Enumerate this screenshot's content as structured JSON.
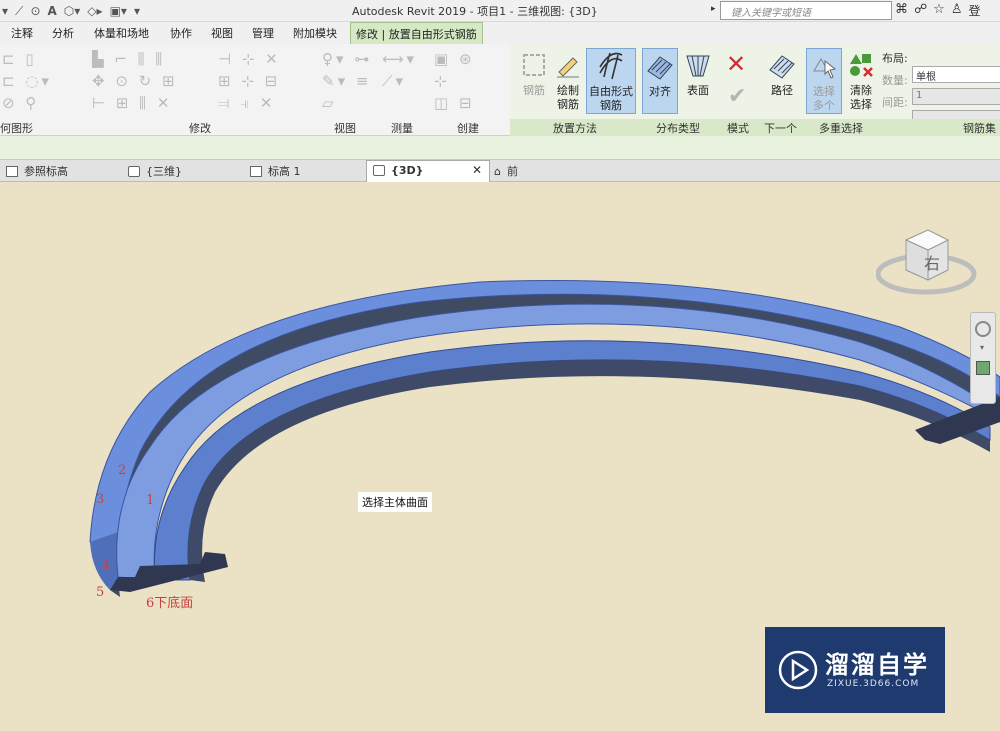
{
  "app": {
    "title": "Autodesk Revit 2019 - 项目1 - 三维视图: {3D}"
  },
  "search": {
    "placeholder": "键入关键字或短语"
  },
  "account": {
    "label": "登"
  },
  "ribbon_tabs": [
    {
      "label": "注释"
    },
    {
      "label": "分析"
    },
    {
      "label": "体量和场地"
    },
    {
      "label": "协作"
    },
    {
      "label": "视图"
    },
    {
      "label": "管理"
    },
    {
      "label": "附加模块"
    },
    {
      "label": "修改 | 放置自由形式钢筋"
    }
  ],
  "panels": {
    "geometry": "何图形",
    "modify": "修改",
    "view": "视图",
    "measure": "测量",
    "create": "创建",
    "placement": "放置方法",
    "distribution": "分布类型",
    "mode": "模式",
    "next": "下一个",
    "multi": "多重选择",
    "rebarset": "钢筋集"
  },
  "buttons": {
    "rebar": "钢筋",
    "sketch_line1": "绘制",
    "sketch_line2": "钢筋",
    "freeform_line1": "自由形式",
    "freeform_line2": "钢筋",
    "align": "对齐",
    "surface": "表面",
    "path": "路径",
    "select_multi_line1": "选择",
    "select_multi_line2": "多个",
    "clear_line1": "清除",
    "clear_line2": "选择"
  },
  "properties": {
    "layout_label": "布局:",
    "layout_value": "单根",
    "count_label": "数量:",
    "count_value": "1",
    "spacing_label": "间距:",
    "spacing_value": ""
  },
  "view_tabs": [
    {
      "label": "参照标高"
    },
    {
      "label": "{三维}"
    },
    {
      "label": "标高 1"
    },
    {
      "label": "{3D}",
      "active": true
    },
    {
      "label": "前"
    }
  ],
  "view_tab_close": "✕",
  "viewport": {
    "hint": "选择主体曲面",
    "labels": [
      "1",
      "2",
      "3",
      "4",
      "5",
      "6下底面"
    ],
    "viewcube_face": "右"
  },
  "watermark": {
    "title": "溜溜自学",
    "url": "ZIXUE.3D66.COM"
  },
  "colors": {
    "ribbon_context": "#d4e9c4",
    "selected_button": "#bcd6f0",
    "canvas": "#ebe2c6",
    "label_red": "#c94040",
    "model_blue": "#5b82d6"
  }
}
